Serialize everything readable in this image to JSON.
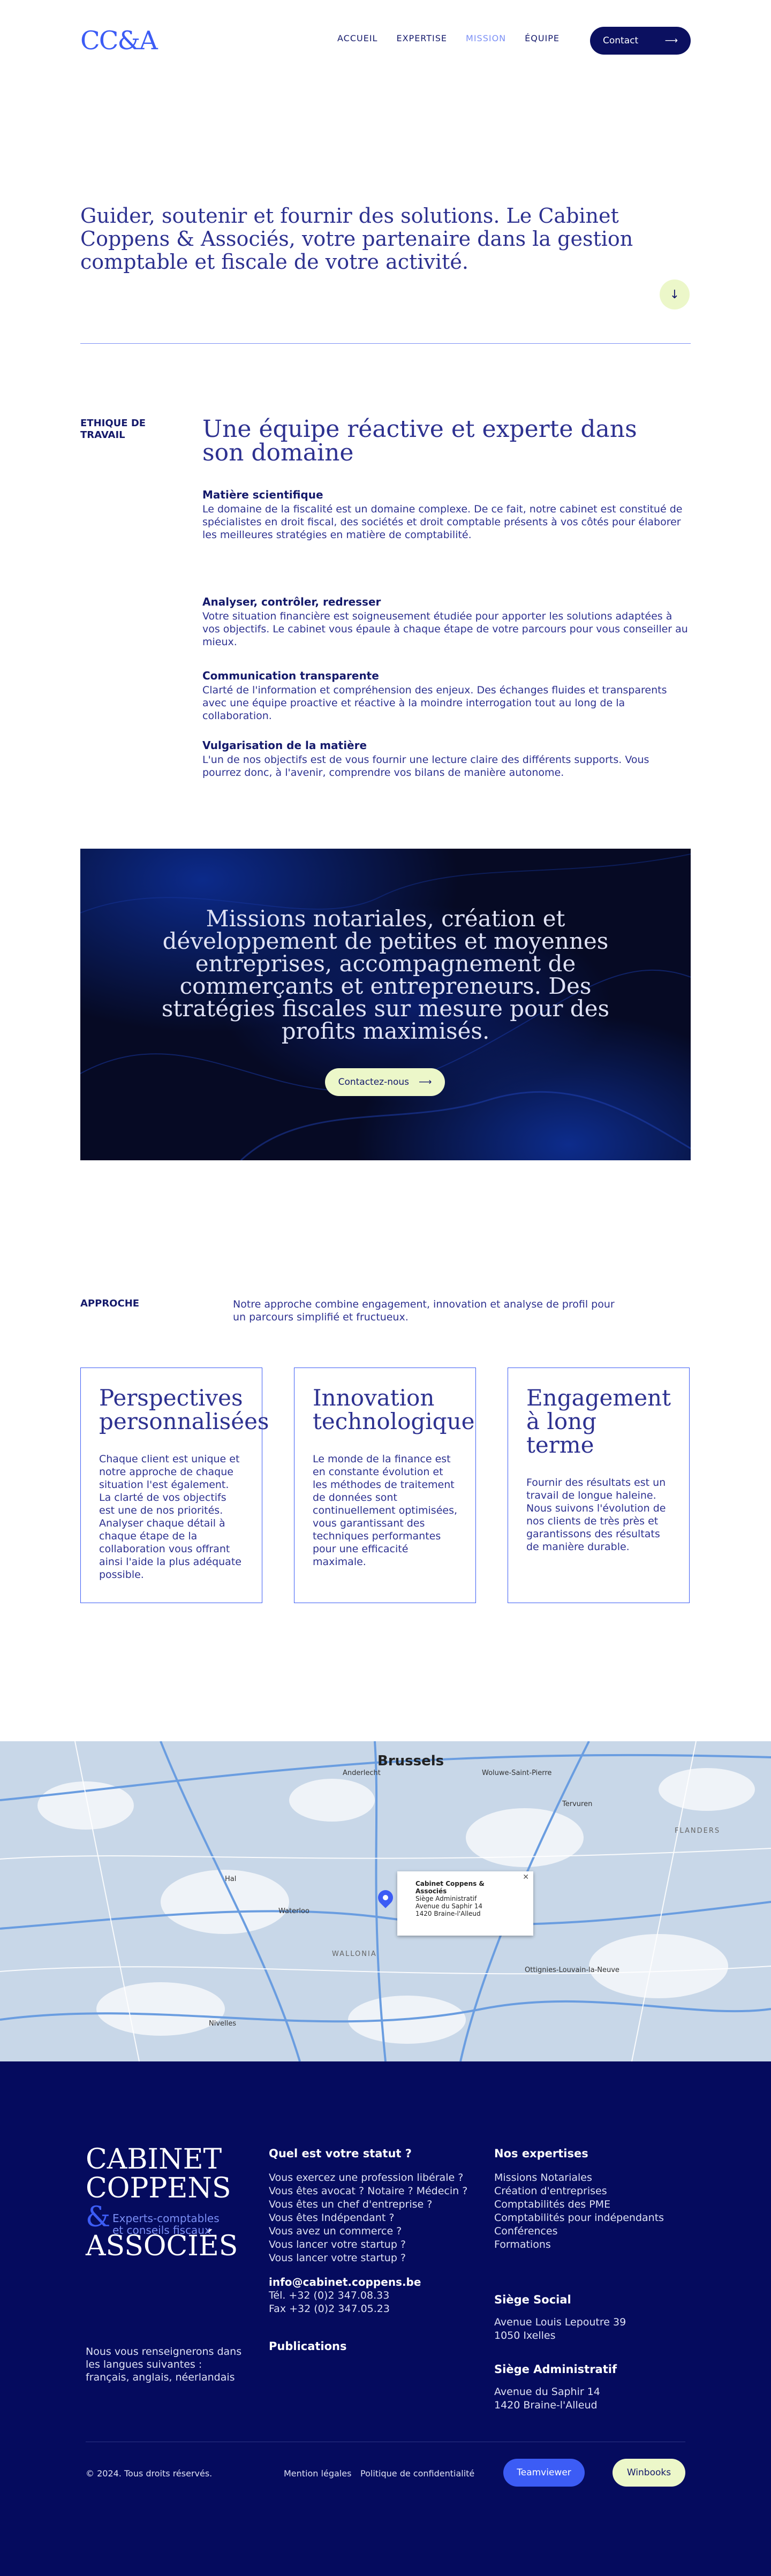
{
  "header": {
    "logo": "CC&A",
    "nav": [
      "ACCUEIL",
      "EXPERTISE",
      "MISSION",
      "ÉQUIPE"
    ],
    "active_nav": "MISSION",
    "contact_label": "Contact"
  },
  "hero": {
    "text": "Guider, soutenir et fournir des solutions. Le Cabinet Coppens & Associés, votre partenaire dans la gestion comptable et fiscale de votre activité."
  },
  "ethique": {
    "label": "ETHIQUE DE TRAVAIL",
    "title": "Une équipe réactive et experte dans son domaine",
    "features": [
      {
        "title": "Matière scientifique",
        "desc": "Le domaine de la fiscalité est un domaine complexe. De ce fait, notre cabinet est constitué de spécialistes en droit fiscal, des sociétés et droit comptable présents à vos côtés pour élaborer les meilleures stratégies en matière de comptabilité."
      },
      {
        "title": "Analyser, contrôler, redresser",
        "desc": "Votre situation financière est soigneusement étudiée pour apporter les solutions adaptées à vos objectifs. Le cabinet vous épaule à chaque étape de votre parcours pour vous conseiller au mieux."
      },
      {
        "title": "Communication transparente",
        "desc": "Clarté de l'information et compréhension des enjeux. Des échanges fluides et transparents avec une équipe proactive et réactive à la moindre interrogation tout au long de la collaboration."
      },
      {
        "title": "Vulgarisation de la matière",
        "desc": "L'un de nos objectifs est de vous fournir une lecture claire des différents supports. Vous pourrez donc, à l'avenir, comprendre vos bilans de manière autonome."
      }
    ]
  },
  "banner": {
    "text": "Missions notariales, création et développement de petites et moyennes entreprises, accompagnement de commerçants et entrepreneurs. Des stratégies fiscales sur mesure pour des profits maximisés.",
    "button": "Contactez-nous"
  },
  "approche": {
    "label": "APPROCHE",
    "desc": "Notre approche combine engagement, innovation et analyse de profil pour un parcours simplifié et fructueux.",
    "cards": [
      {
        "title": "Perspectives personnalisées",
        "desc": "Chaque client est unique et notre approche de chaque situation l'est également. La clarté de vos objectifs est une de nos priorités. Analyser chaque détail à chaque étape de la collaboration vous offrant ainsi l'aide la plus adéquate possible."
      },
      {
        "title": "Innovation technologique",
        "desc": "Le monde de la finance est en constante évolution et les méthodes de traitement de données sont continuellement optimisées, vous garantissant des techniques performantes pour une efficacité maximale."
      },
      {
        "title": "Engagement à long terme",
        "desc": "Fournir des résultats est un travail de longue haleine. Nous suivons l'évolution de nos clients de très près et garantissons des résultats de manière durable."
      }
    ]
  },
  "map": {
    "city": "Brussels",
    "places": [
      "Anderlecht",
      "Woluwe-Saint-Pierre",
      "Tervuren",
      "FLANDERS",
      "WALLONIA",
      "Waterloo",
      "Ottignies-Louvain-la-Neuve",
      "Hal",
      "Nivelles"
    ],
    "popup": {
      "title": "Cabinet Coppens & Associés",
      "line1": "Siège Administratif",
      "line2": "Avenue du Saphir 14",
      "line3": "1420 Braine-l'Alleud"
    }
  },
  "footer": {
    "logo_line1": "CABINET",
    "logo_line2": "COPPENS",
    "logo_amp": "&",
    "logo_line3": "ASSOCIÉS",
    "logo_sub1": "Experts-comptables",
    "logo_sub2": "et conseils fiscaux",
    "languages": "Nous vous renseignerons dans les langues suivantes : français, anglais, néerlandais",
    "status_title": "Quel est votre statut ?",
    "status_items": [
      "Vous exercez une profession libérale ?",
      "Vous êtes avocat ? Notaire ? Médecin ?",
      "Vous êtes un chef d'entreprise ?",
      "Vous êtes Indépendant ?",
      "Vous avez un commerce ?",
      "Vous lancer votre startup ?",
      "Vous lancer votre startup ?"
    ],
    "email": "info@cabinet.coppens.be",
    "tel": "Tél. +32 (0)2 347.08.33",
    "fax": "Fax +32 (0)2 347.05.23",
    "publications": "Publications",
    "expertises_title": "Nos expertises",
    "expertises": [
      "Missions Notariales",
      "Création d'entreprises",
      "Comptabilités des PME",
      "Comptabilités pour indépendants",
      "Conférences",
      "Formations"
    ],
    "siege_social_title": "Siège Social",
    "siege_social_1": "Avenue Louis Lepoutre 39",
    "siege_social_2": "1050 Ixelles",
    "siege_admin_title": "Siège Administratif",
    "siege_admin_1": "Avenue du Saphir 14",
    "siege_admin_2": "1420 Braine-l'Alleud",
    "copyright": "© 2024. Tous droits réservés.",
    "legal": "Mention légales",
    "privacy": "Politique de confidentialité",
    "teamviewer": "Teamviewer",
    "winbooks": "Winbooks"
  },
  "colors": {
    "accent": "#3c5cf5",
    "navy": "#050b5e",
    "lime": "#ecf7c9"
  }
}
